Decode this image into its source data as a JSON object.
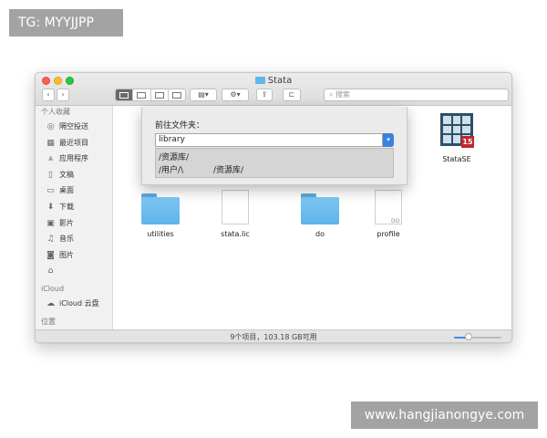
{
  "watermarks": {
    "top": "TG: MYYJJPP",
    "bottom": "www.hangjianongye.com"
  },
  "window": {
    "title": "Stata",
    "nav": {
      "back_icon": "‹",
      "forward_icon": "›"
    },
    "search": {
      "placeholder": "搜索"
    }
  },
  "sidebar": {
    "sections": [
      {
        "header": "个人收藏",
        "items": [
          {
            "label": "隔空投送",
            "icon": "airdrop-icon"
          },
          {
            "label": "最近项目",
            "icon": "recents-icon"
          },
          {
            "label": "应用程序",
            "icon": "applications-icon"
          },
          {
            "label": "文稿",
            "icon": "documents-icon"
          },
          {
            "label": "桌面",
            "icon": "desktop-icon"
          },
          {
            "label": "下载",
            "icon": "downloads-icon"
          },
          {
            "label": "影片",
            "icon": "movies-icon"
          },
          {
            "label": "音乐",
            "icon": "music-icon"
          },
          {
            "label": "图片",
            "icon": "pictures-icon"
          },
          {
            "label": "",
            "icon": "home-icon"
          }
        ]
      },
      {
        "header": "iCloud",
        "items": [
          {
            "label": "iCloud 云盘",
            "icon": "icloud-drive-icon"
          }
        ]
      },
      {
        "header": "位置",
        "items": []
      }
    ]
  },
  "files": [
    {
      "name": "StataSE",
      "kind": "app",
      "badge": "15"
    },
    {
      "name": "utilities",
      "kind": "folder"
    },
    {
      "name": "stata.lic",
      "kind": "document"
    },
    {
      "name": "do",
      "kind": "folder"
    },
    {
      "name": "profile",
      "kind": "document",
      "tag": "DO"
    }
  ],
  "status": {
    "text": "9个项目，103.18 GB可用",
    "icon_size_level": 0.3
  },
  "goto_dialog": {
    "label": "前往文件夹：",
    "value": "library",
    "suggestions": [
      "/资源库/",
      "/用户/\\",
      "/资源库/"
    ]
  },
  "colors": {
    "folder_blue": "#5fb3e8",
    "selection_blue": "#3b82e0",
    "stata_badge_red": "#c1272d"
  }
}
